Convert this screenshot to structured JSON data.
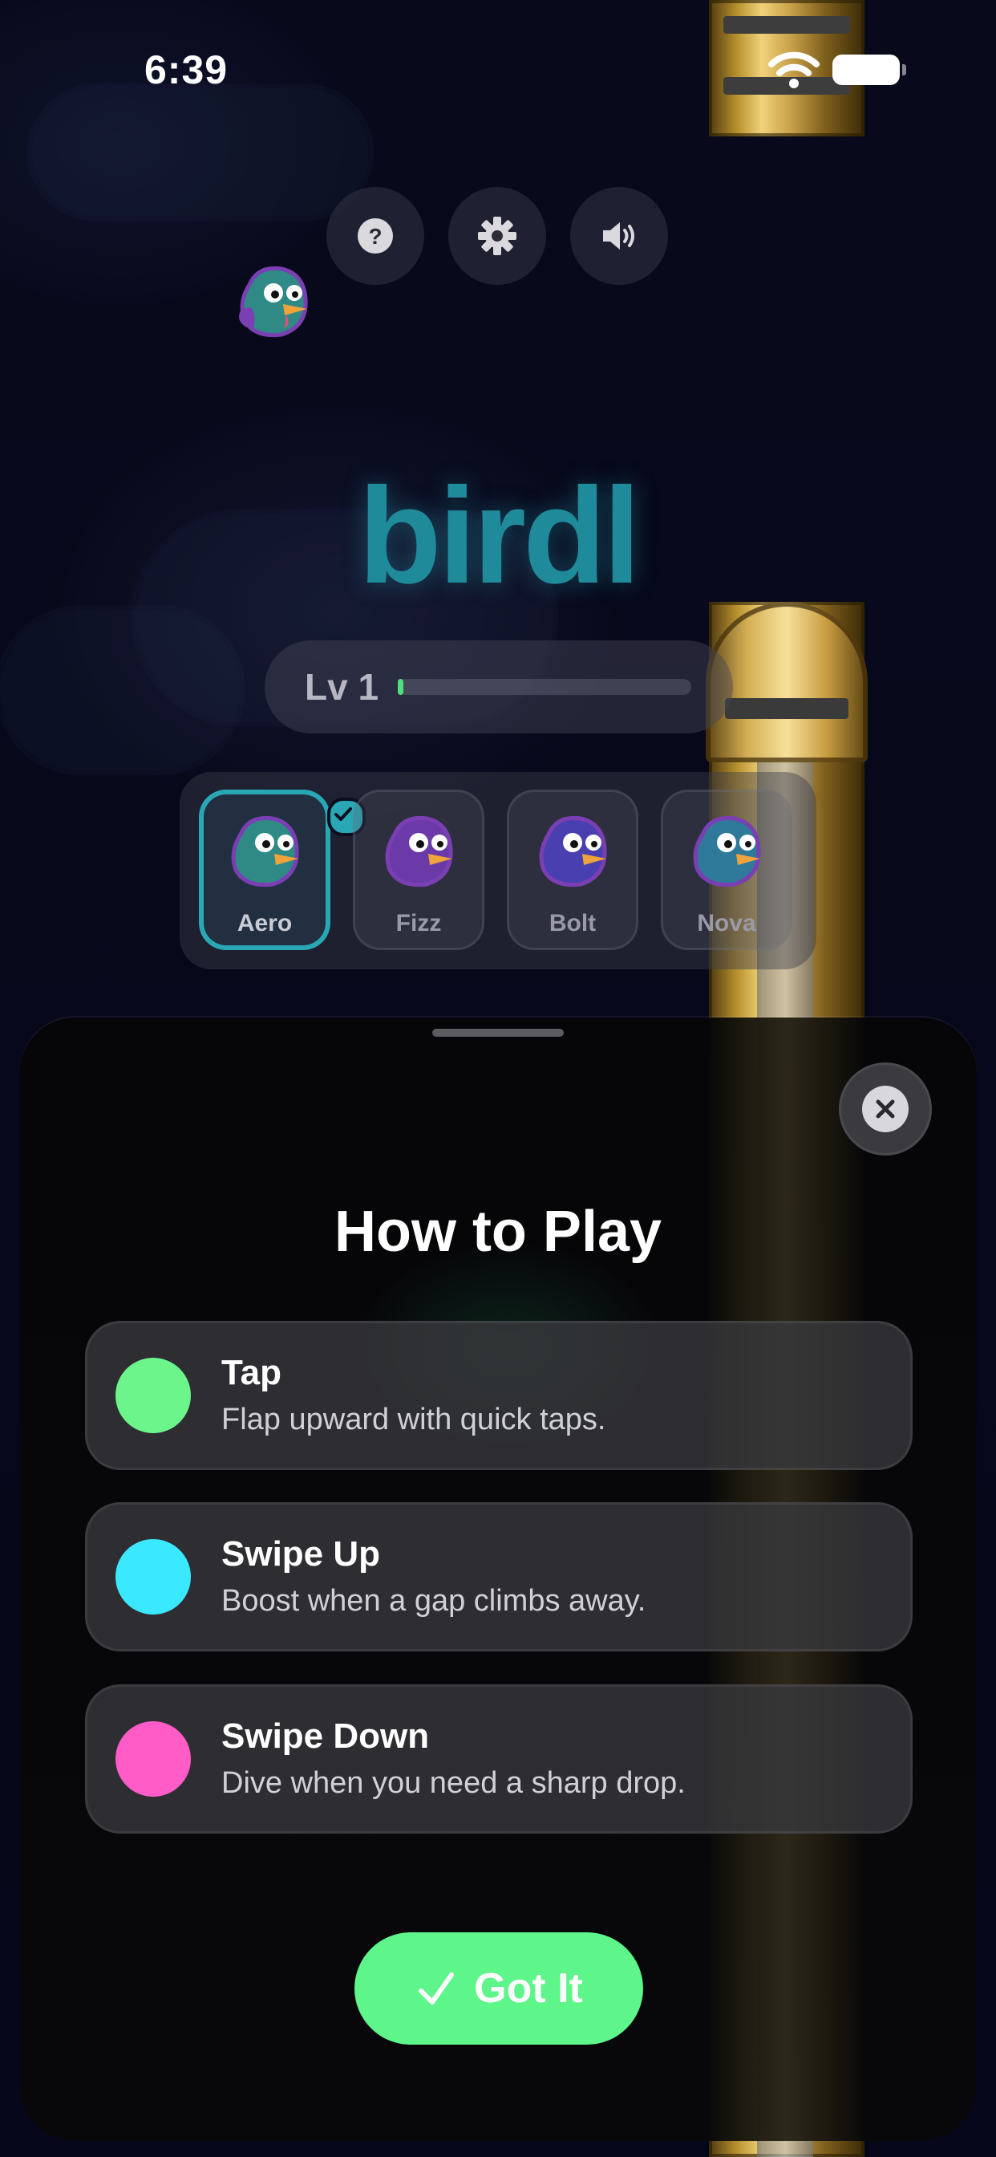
{
  "status_bar": {
    "time": "6:39"
  },
  "top_buttons": [
    {
      "icon": "help-icon"
    },
    {
      "icon": "gear-icon"
    },
    {
      "icon": "speaker-icon"
    }
  ],
  "logo": "birdl",
  "level": {
    "label": "Lv 1",
    "progress": 0.02
  },
  "characters": [
    {
      "name": "Aero",
      "selected": true
    },
    {
      "name": "Fizz",
      "selected": false
    },
    {
      "name": "Bolt",
      "selected": false
    },
    {
      "name": "Nova",
      "selected": false
    }
  ],
  "sheet": {
    "title": "How to Play",
    "items": [
      {
        "title": "Tap",
        "description": "Flap upward with quick taps.",
        "color": "#6cf58a"
      },
      {
        "title": "Swipe Up",
        "description": "Boost when a gap climbs away.",
        "color": "#3ae8ff"
      },
      {
        "title": "Swipe Down",
        "description": "Dive when you need a sharp drop.",
        "color": "#ff5cc8"
      }
    ],
    "confirm_label": "Got It",
    "accent": "#5ef58a"
  }
}
